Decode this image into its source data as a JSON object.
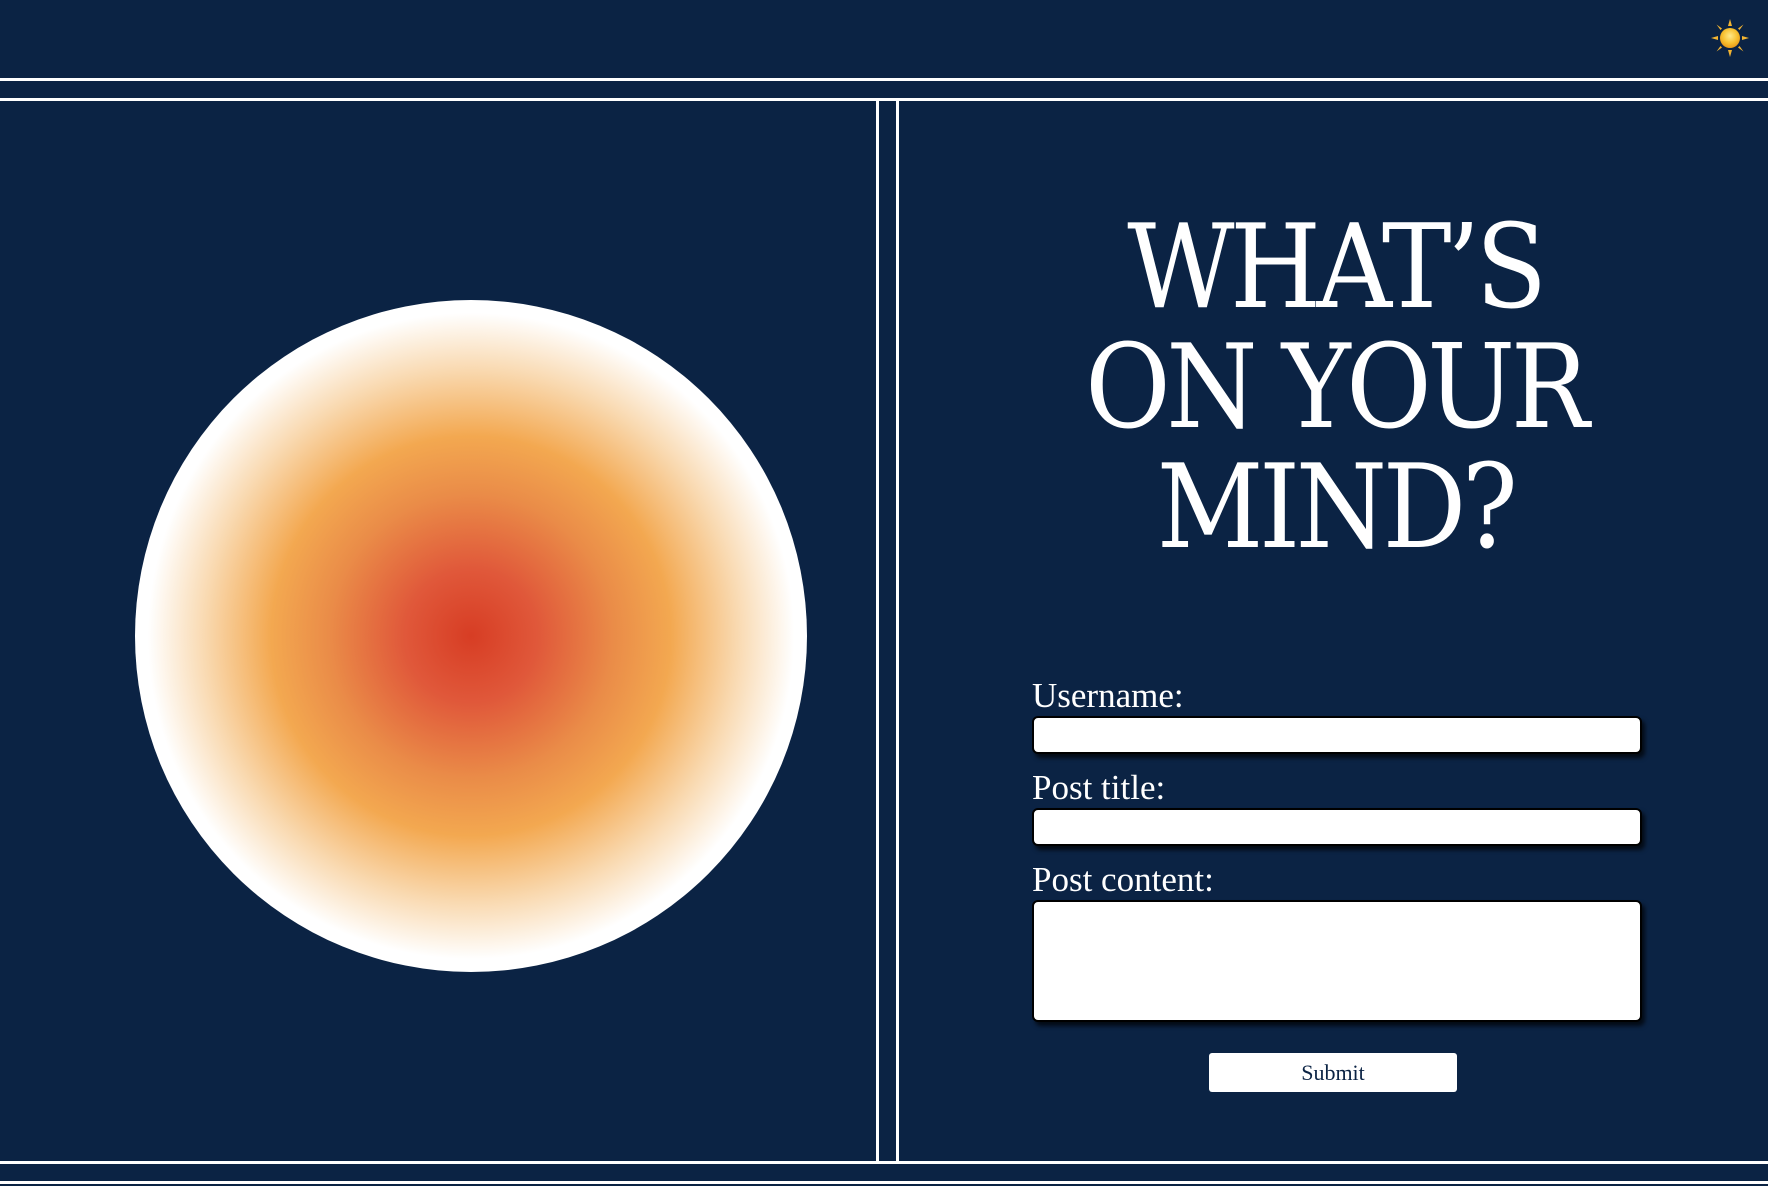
{
  "header": {
    "theme_toggle_icon": "sun-icon"
  },
  "hero": {
    "orb": "gradient-orb",
    "colors": {
      "background": "#0b2344",
      "orb_center": "#d73d24",
      "orb_mid": "#f3a850",
      "orb_ring": "#ffffff"
    }
  },
  "main": {
    "headline_line1": "WHAT’S",
    "headline_line2": "ON YOUR",
    "headline_line3": "MIND?"
  },
  "form": {
    "username_label": "Username:",
    "username_value": "",
    "post_title_label": "Post title:",
    "post_title_value": "",
    "post_content_label": "Post content:",
    "post_content_value": "",
    "submit_label": "Submit"
  }
}
